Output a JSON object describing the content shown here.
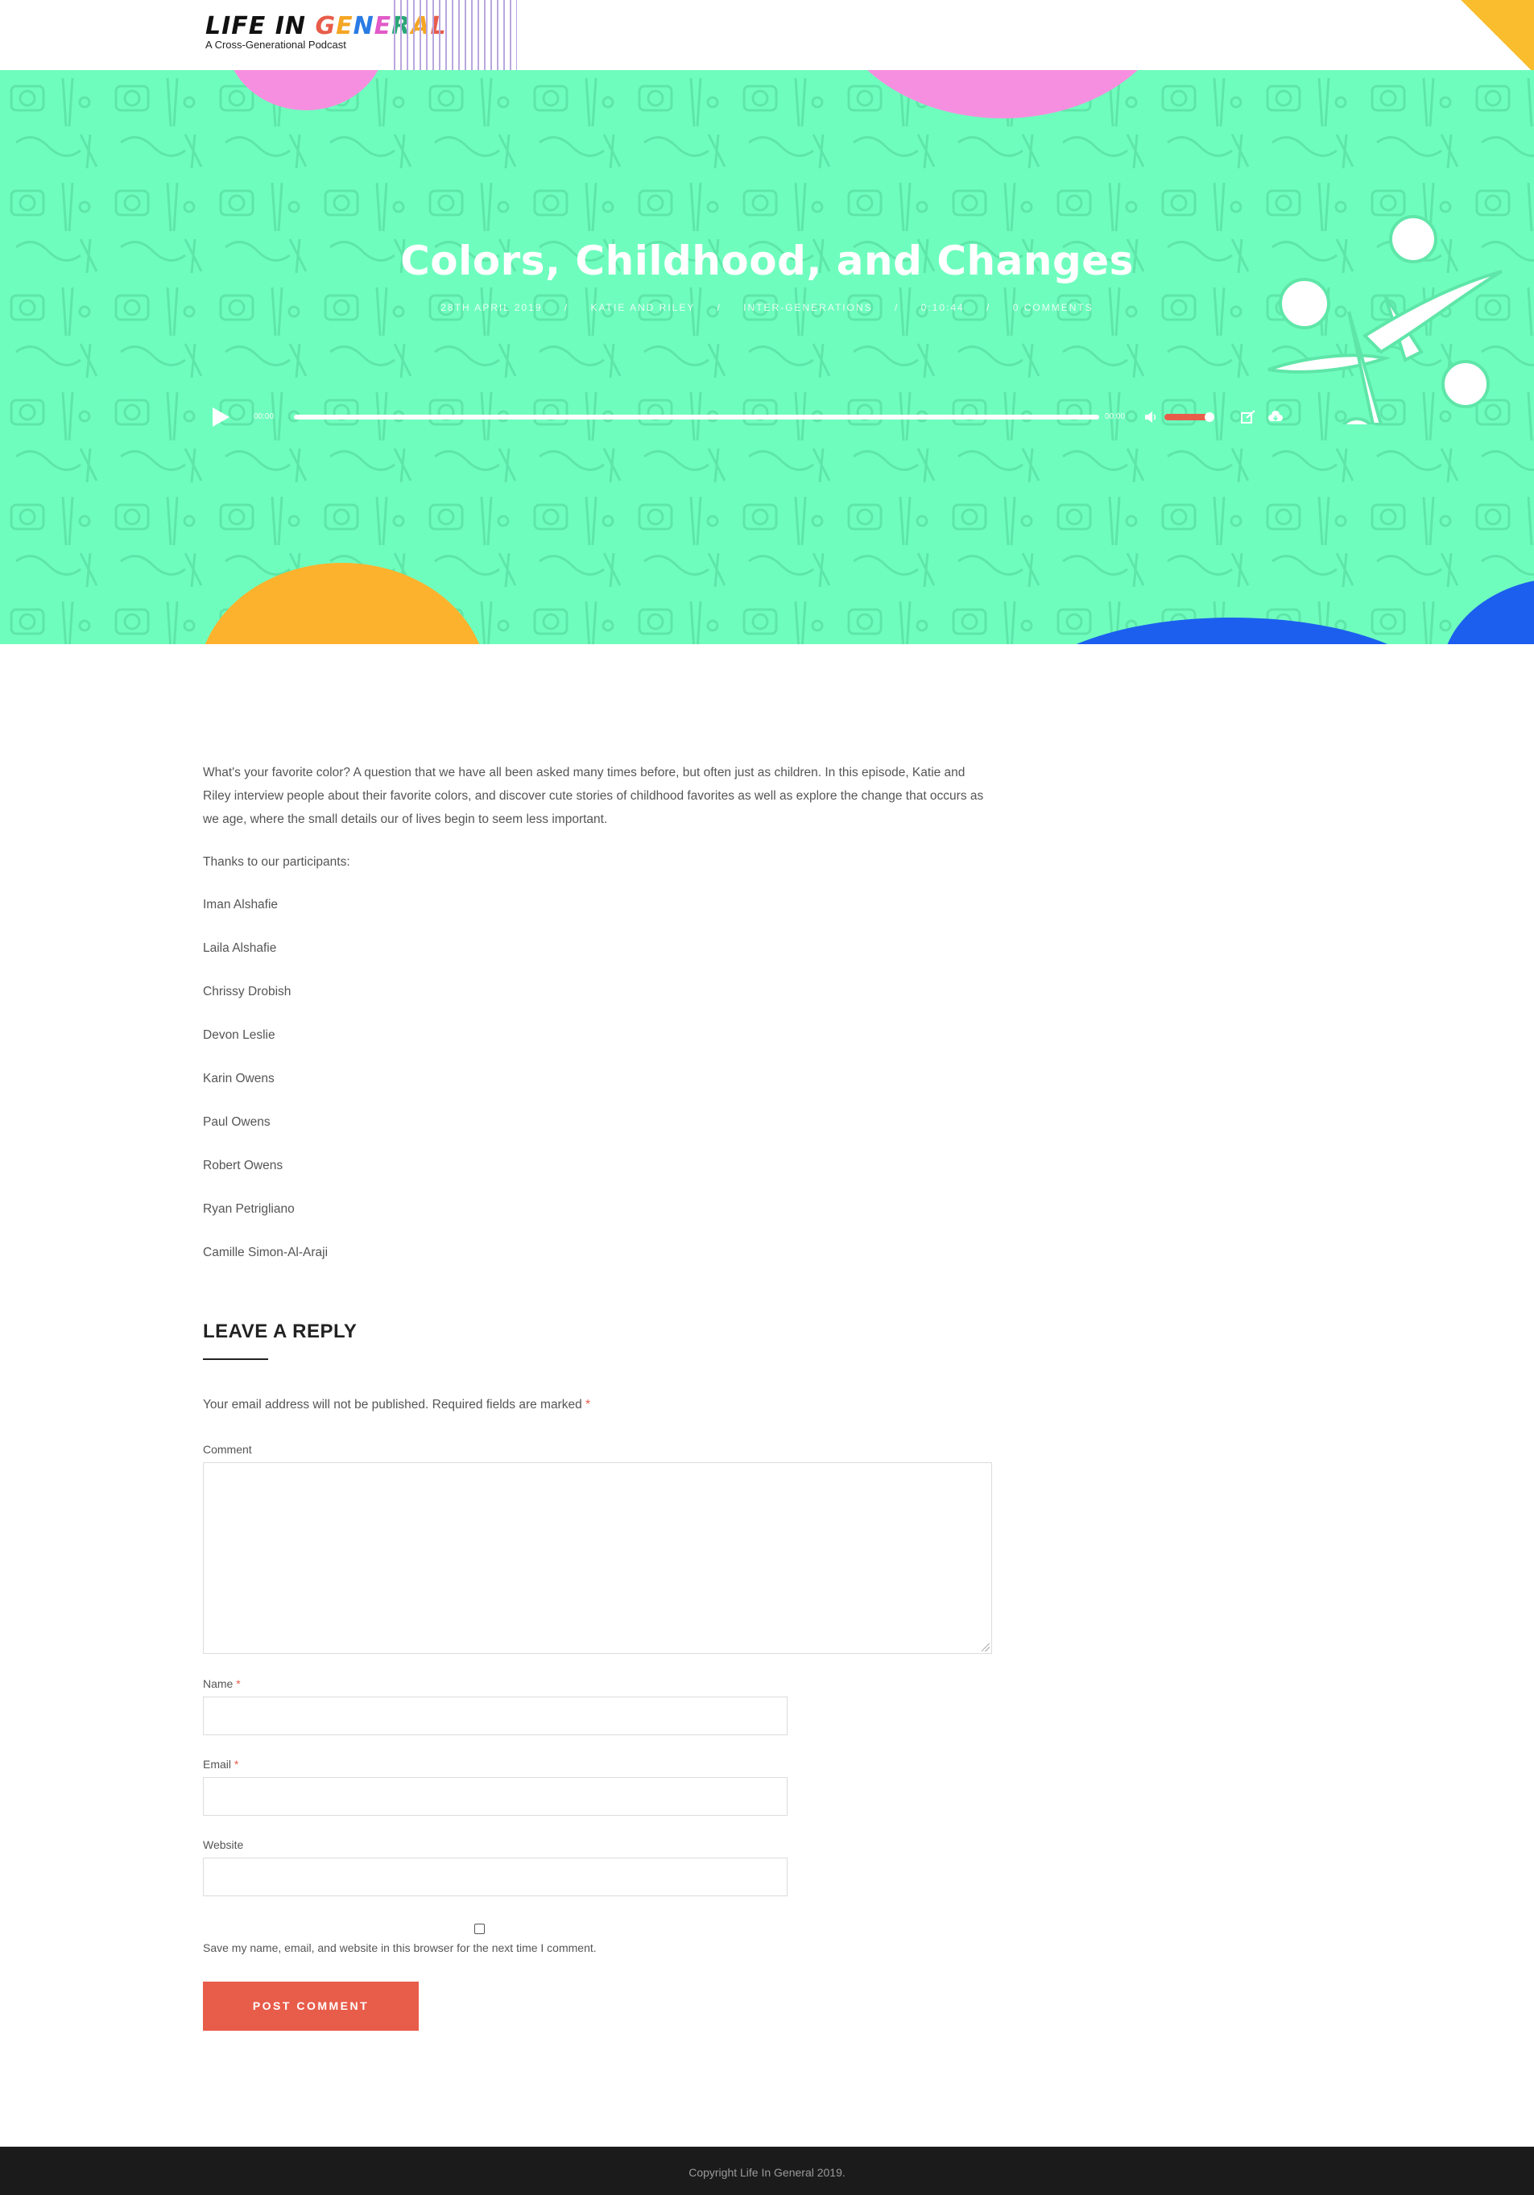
{
  "header": {
    "logo_title": "LIFE IN GENERAL",
    "logo_subtitle": "A Cross-Generational Podcast"
  },
  "hero": {
    "title": "Colors, Childhood, and Changes",
    "meta": [
      "28th April 2019",
      "Katie and Riley",
      "Inter-generations",
      "0:10:44",
      "0 Comments"
    ],
    "meta_separator": "/",
    "background_color": "#6ffdbe"
  },
  "player": {
    "current_time": "00:00",
    "duration": "00:00",
    "progress": 0,
    "volume": 0.8,
    "accent_color": "#e85c4a",
    "icons": [
      "play-icon",
      "volume-icon",
      "embed-icon",
      "download-icon"
    ]
  },
  "article": {
    "intro": "What's your favorite color? A question that we have all been asked many times before, but often just as children. In this episode, Katie and Riley interview people about their favorite colors, and discover cute stories of childhood favorites as well as explore the change that occurs as we age, where the small details our of lives begin to seem less important.",
    "thanks": "Thanks to our participants:",
    "participants": [
      "Iman Alshafie",
      "Laila Alshafie",
      "Chrissy Drobish",
      "Devon Leslie",
      "Karin Owens",
      "Paul Owens",
      "Robert Owens",
      "Ryan Petrigliano",
      "Camille Simon-Al-Araji"
    ]
  },
  "reply": {
    "title": "LEAVE A REPLY",
    "notice": "Your email address will not be published. Required fields are marked",
    "required_mark": "*",
    "comment_label": "Comment",
    "name_label": "Name",
    "email_label": "Email",
    "website_label": "Website",
    "save_note": "Save my name, email, and website in this browser for the next time I comment.",
    "submit_label": "POST COMMENT"
  },
  "footer": {
    "copyright": "Copyright Life In General 2019."
  }
}
